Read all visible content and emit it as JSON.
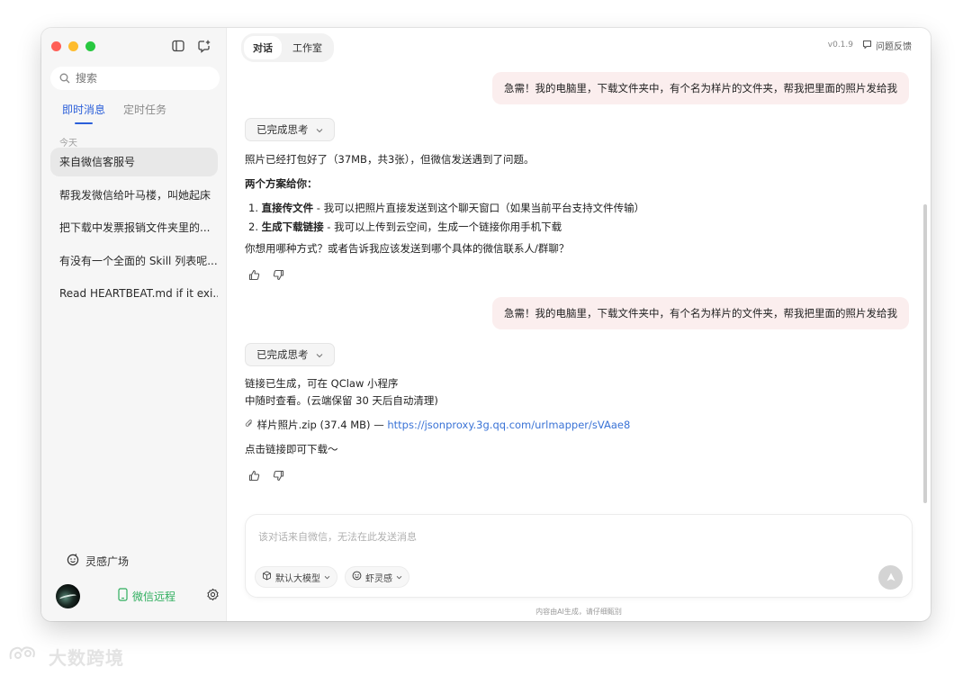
{
  "window": {
    "traffic_lights": [
      "#ff5f57",
      "#febc2e",
      "#28c840"
    ],
    "accent": "#2b5fd9",
    "green": "#2fae5e"
  },
  "sidebar": {
    "search_placeholder": "搜索",
    "tabs": [
      {
        "label": "即时消息",
        "active": true
      },
      {
        "label": "定时任务",
        "active": false
      }
    ],
    "section": "今天",
    "conversations": [
      {
        "label": "来自微信客服号",
        "active": true
      },
      {
        "label": "帮我发微信给叶马楼，叫她起床",
        "active": false
      },
      {
        "label": "把下载中发票报销文件夹里的...",
        "active": false
      },
      {
        "label": "有没有一个全面的 Skill 列表呢...",
        "active": false
      },
      {
        "label": "Read HEARTBEAT.md if it exi...",
        "active": false
      }
    ],
    "inspire_label": "灵感广场",
    "wechat_remote_label": "微信远程"
  },
  "header": {
    "tabs": [
      {
        "label": "对话",
        "active": true
      },
      {
        "label": "工作室",
        "active": false
      }
    ],
    "version": "v0.1.9",
    "feedback_label": "问题反馈"
  },
  "messages": {
    "user_1": "急需！我的电脑里，下载文件夹中，有个名为样片的文件夹，帮我把里面的照片发给我",
    "think_1": "已完成思考",
    "reply_1": {
      "line1": "照片已经打包好了（37MB，共3张），但微信发送遇到了问题。",
      "line2": "两个方案给你：",
      "opt1_num": "1.",
      "opt1_bold": "直接传文件",
      "opt1_rest": " - 我可以把照片直接发送到这个聊天窗口（如果当前平台支持文件传输）",
      "opt2_num": "2.",
      "opt2_bold": "生成下载链接",
      "opt2_rest": " - 我可以上传到云空间，生成一个链接你用手机下载",
      "line3": "你想用哪种方式？或者告诉我应该发送到哪个具体的微信联系人/群聊？"
    },
    "user_2": "急需！我的电脑里，下载文件夹中，有个名为样片的文件夹，帮我把里面的照片发给我",
    "think_2": "已完成思考",
    "reply_2": {
      "line1": "链接已生成，可在 QClaw 小程序",
      "line2": "中随时查看。(云端保留 30 天后自动清理)",
      "file_label": "样片照片.zip (37.4 MB) —",
      "link": "https://jsonproxy.3g.qq.com/urlmapper/sVAae8",
      "line3": "点击链接即可下载～"
    }
  },
  "composer": {
    "placeholder": "该对话来自微信，无法在此发送消息",
    "model_chip": "默认大模型",
    "skill_chip": "虾灵感"
  },
  "footer_note": "内容由AI生成，请仔细甄别",
  "watermark": "大数跨境"
}
